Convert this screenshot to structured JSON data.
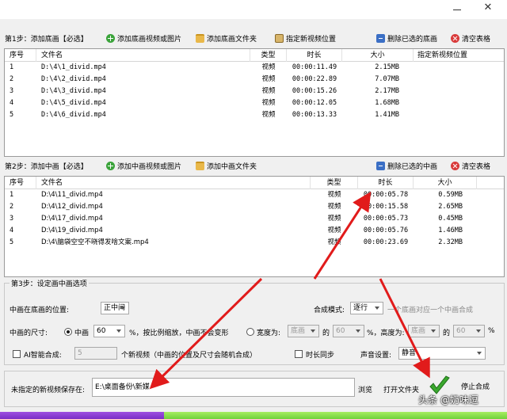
{
  "window": {
    "minimize_glyph": "—",
    "close_glyph": "✕"
  },
  "step1": {
    "label": "第1步：添加底画【必选】",
    "buttons": {
      "add_video_image": "添加底画视频或图片",
      "add_folder": "添加底画文件夹",
      "set_location": "指定新视频位置",
      "delete_selected": "删除已选的底画",
      "clear": "清空表格"
    },
    "columns": [
      "序号",
      "文件名",
      "类型",
      "时长",
      "大小",
      "指定新视频位置"
    ],
    "rows": [
      {
        "no": "1",
        "file": "D:\\4\\1_divid.mp4",
        "type": "视频",
        "duration": "00:00:11.49",
        "size": "2.15MB"
      },
      {
        "no": "2",
        "file": "D:\\4\\2_divid.mp4",
        "type": "视频",
        "duration": "00:00:22.89",
        "size": "7.07MB"
      },
      {
        "no": "3",
        "file": "D:\\4\\3_divid.mp4",
        "type": "视频",
        "duration": "00:00:15.26",
        "size": "2.17MB"
      },
      {
        "no": "4",
        "file": "D:\\4\\5_divid.mp4",
        "type": "视频",
        "duration": "00:00:12.05",
        "size": "1.68MB"
      },
      {
        "no": "5",
        "file": "D:\\4\\6_divid.mp4",
        "type": "视频",
        "duration": "00:00:13.33",
        "size": "1.41MB"
      }
    ]
  },
  "step2": {
    "label": "第2步：添加中画【必选】",
    "buttons": {
      "add_video_image": "添加中画视频或图片",
      "add_folder": "添加中画文件夹",
      "delete_selected": "删除已选的中画",
      "clear": "清空表格"
    },
    "columns": [
      "序号",
      "文件名",
      "类型",
      "时长",
      "大小"
    ],
    "rows": [
      {
        "no": "1",
        "file": "D:\\4\\11_divid.mp4",
        "type": "视频",
        "duration": "00:00:05.78",
        "size": "0.59MB"
      },
      {
        "no": "2",
        "file": "D:\\4\\12_divid.mp4",
        "type": "视频",
        "duration": "00:00:15.58",
        "size": "2.65MB"
      },
      {
        "no": "3",
        "file": "D:\\4\\17_divid.mp4",
        "type": "视频",
        "duration": "00:00:05.73",
        "size": "0.45MB"
      },
      {
        "no": "4",
        "file": "D:\\4\\19_divid.mp4",
        "type": "视频",
        "duration": "00:00:05.76",
        "size": "1.46MB"
      },
      {
        "no": "5",
        "file": "D:\\4\\脑袋空空不晓得发啥文案.mp4",
        "type": "视频",
        "duration": "00:00:23.69",
        "size": "2.32MB"
      }
    ]
  },
  "step3": {
    "label": "第3步：设定画中画选项",
    "position_label": "中画在底画的位置:",
    "position_value": "正中间",
    "mode_label": "合成模式:",
    "mode_value": "逐行",
    "mode_hint": "一个底画对应一个中画合成",
    "size_label": "中画的尺寸:",
    "size_scale_label": "中画",
    "size_scale_value": "60",
    "size_scale_hint": "%，按比例缩放，中画不会变形",
    "width_label": "宽度为:",
    "width_ref": "底画",
    "of_label": "的",
    "width_value": "60",
    "height_label": "%，高度为:",
    "height_ref": "底画",
    "height_value": "60",
    "pct": "%",
    "ai_label": "AI智能合成:",
    "ai_count": "5",
    "ai_hint": "个新视频（中画的位置及尺寸会随机合成）",
    "sync_label": "时长同步",
    "audio_label": "声音设置:",
    "audio_value": "静音"
  },
  "save": {
    "label": "未指定的新视频保存在:",
    "path": "E:\\桌面备份\\新媒",
    "browse": "浏览",
    "open_folder": "打开文件夹",
    "stop": "停止合成"
  },
  "progress": {
    "merged_fraction": 0.323
  },
  "watermark": "头条 @奶味逗"
}
